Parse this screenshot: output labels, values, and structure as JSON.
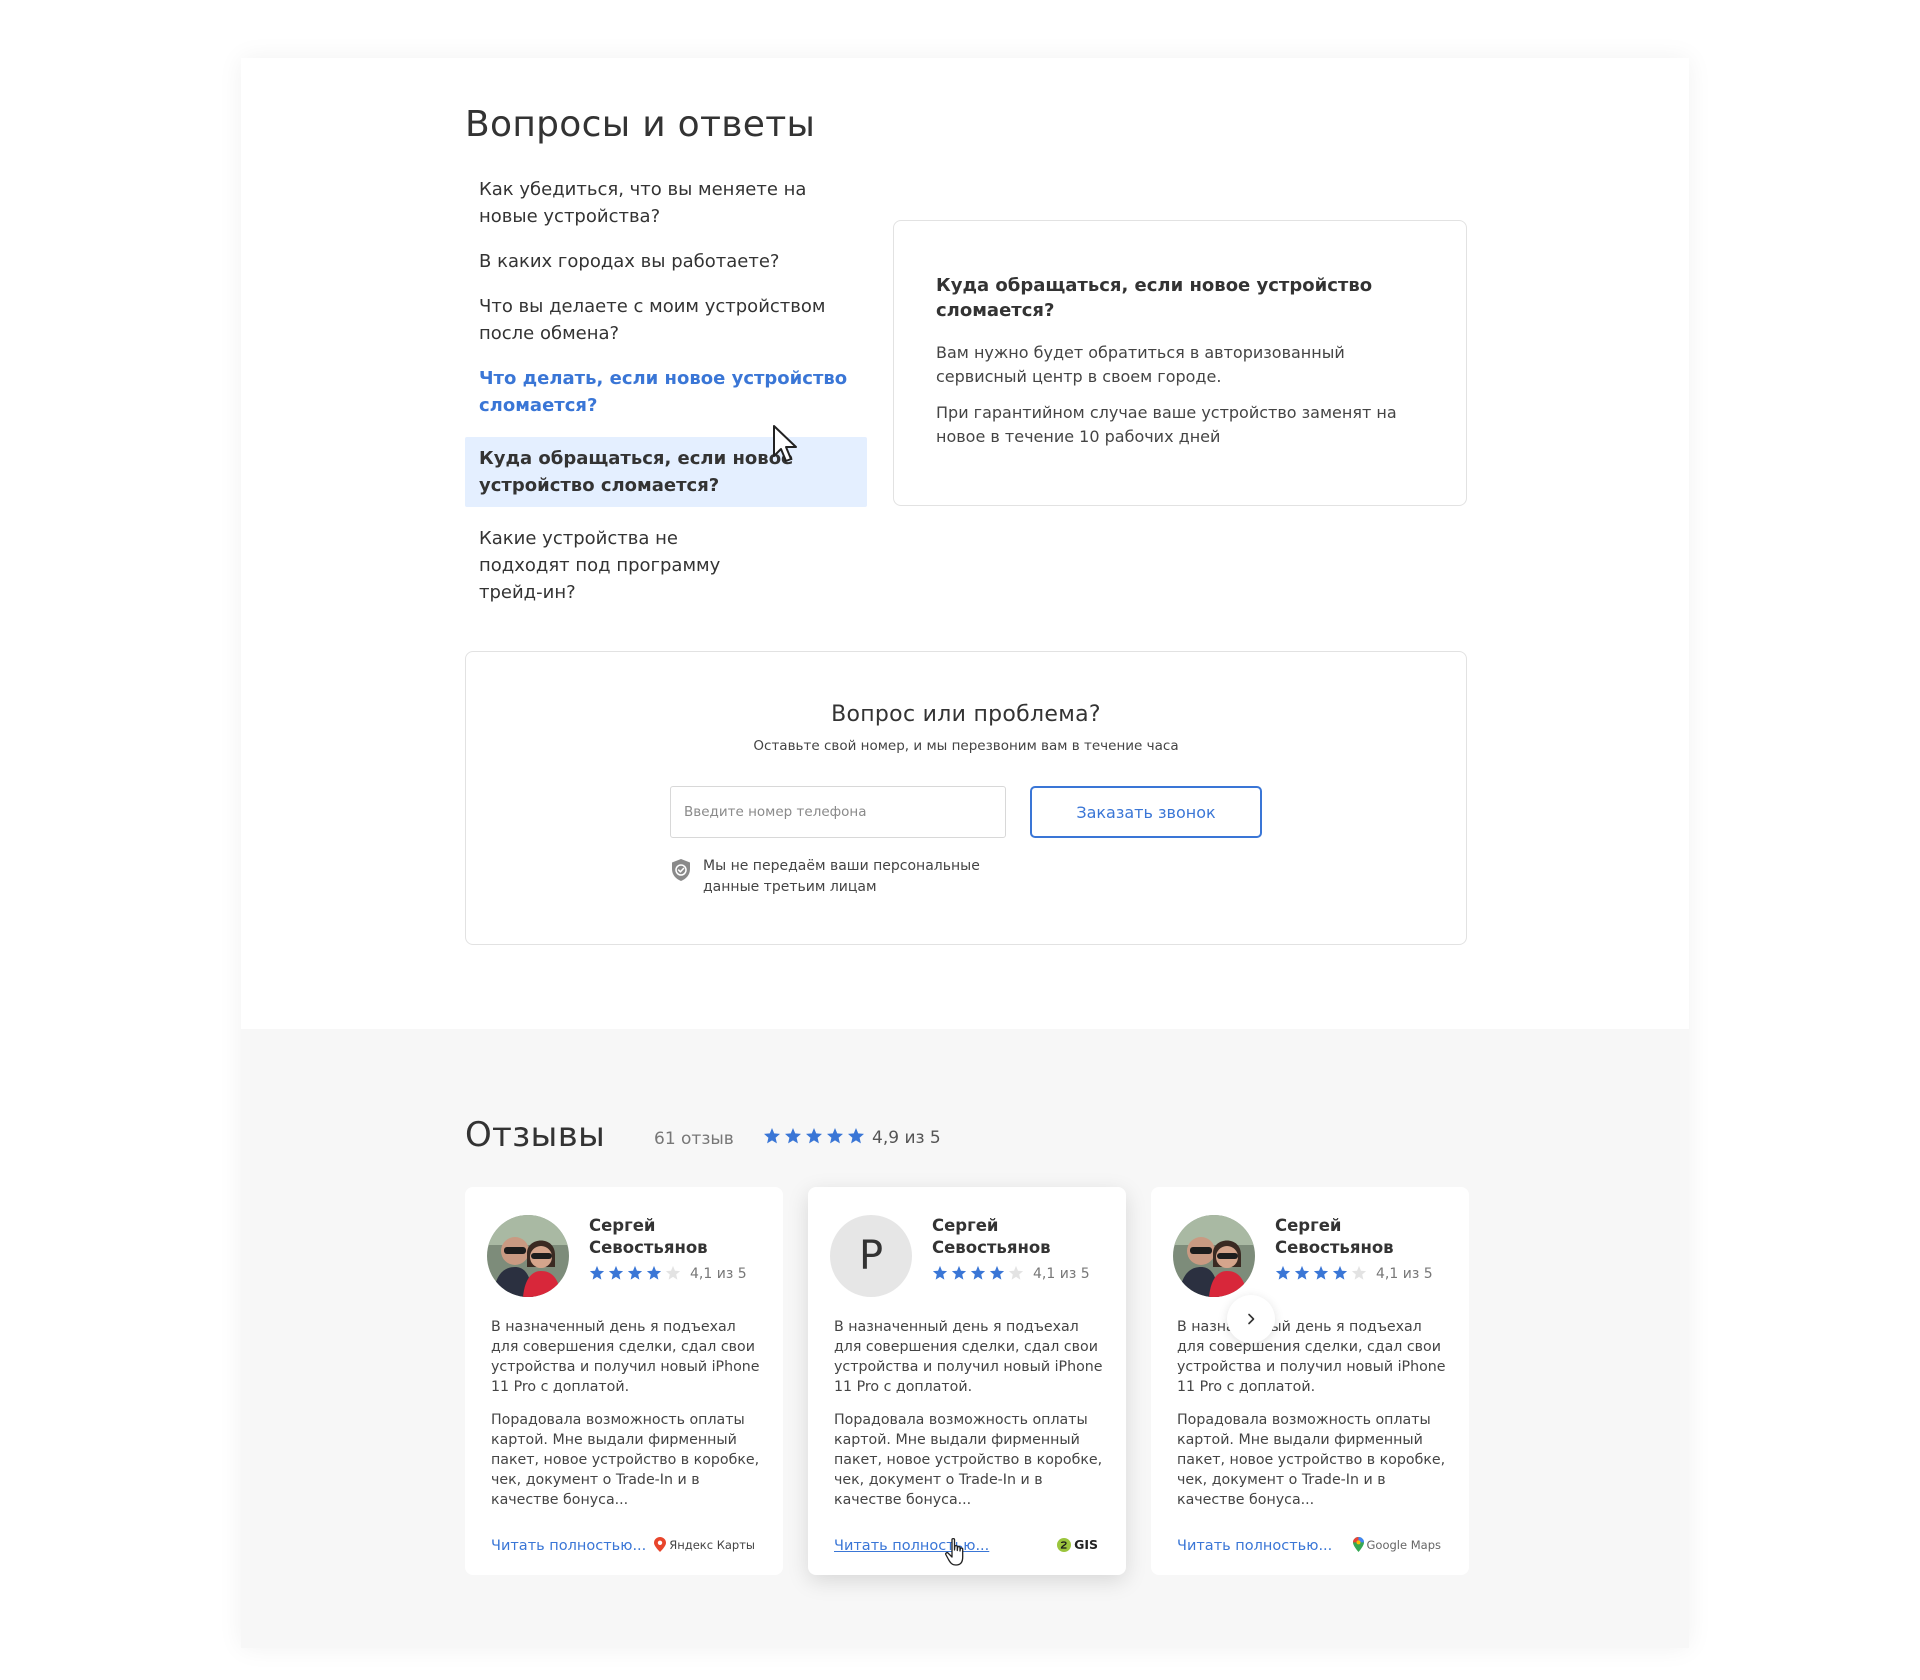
{
  "faq": {
    "title": "Вопросы и ответы",
    "questions": [
      "Как убедиться, что вы меняете на новые устройства?",
      "В каких городах вы работаете?",
      "Что вы делаете с моим устройством после обмена?",
      "Что делать, если новое устройство сломается?",
      "Куда обращаться, если новое устройство сломается?",
      "Какие устройства не подходят под программу трейд-ин?"
    ],
    "answer": {
      "title": "Куда обращаться, если новое устройство сломается?",
      "paragraphs": [
        "Вам нужно будет обратиться в авторизованный сервисный центр в своем городе.",
        "При гарантийном случае ваше устройство заменят на новое в течение 10 рабочих дней"
      ]
    }
  },
  "callback": {
    "title": "Вопрос или проблема?",
    "subtitle": "Оставьте свой номер, и мы перезвоним вам в течение часа",
    "phone_placeholder": "Введите номер телефона",
    "button_label": "Заказать звонок",
    "privacy_text": "Мы не передаём ваши персональные данные третьим лицам"
  },
  "reviews": {
    "title": "Отзывы",
    "count": "61 отзыв",
    "rating_text": "4,9 из 5",
    "rating_value": 4.9,
    "cards": [
      {
        "name": "Сергей Севостьянов",
        "avatar_letter": "",
        "rating_value": 4.1,
        "rating_text": "4,1 из 5",
        "paragraphs": [
          "В назначенный день я подъехал для совершения сделки, сдал свои устройства и получил новый iPhone 11 Pro с доплатой.",
          "Порадовала возможность оплаты картой. Мне выдали фирменный пакет, новое устройство в коробке, чек, документ о Trade-In и в качестве бонуса..."
        ],
        "link": "Читать полностью...",
        "source": "Яндекс Карты"
      },
      {
        "name": "Сергей Севостьянов",
        "avatar_letter": "Р",
        "rating_value": 4.1,
        "rating_text": "4,1 из 5",
        "paragraphs": [
          "В назначенный день я подъехал для совершения сделки, сдал свои устройства и получил новый iPhone 11 Pro с доплатой.",
          "Порадовала возможность оплаты картой. Мне выдали фирменный пакет, новое устройство в коробке, чек, документ о Trade-In и в качестве бонуса..."
        ],
        "link": "Читать полностью...",
        "source": "GIS"
      },
      {
        "name": "Сергей Севостьянов",
        "avatar_letter": "",
        "rating_value": 4.1,
        "rating_text": "4,1 из 5",
        "paragraphs": [
          "В назначенный день я подъехал для совершения сделки, сдал свои устройства и получил новый iPhone 11 Pro с доплатой.",
          "Порадовала возможность оплаты картой. Мне выдали фирменный пакет, новое устройство в коробке, чек, документ о Trade-In и в качестве бонуса..."
        ],
        "link": "Читать полностью...",
        "source": "Google Maps"
      }
    ]
  },
  "colors": {
    "accent": "#3a76d6",
    "active_bg": "#e4efff",
    "section_bg": "#f7f7f7"
  },
  "icons": [
    "cursor-arrow-icon",
    "shield-check-icon",
    "star-icon",
    "yandex-maps-pin-icon",
    "2gis-icon",
    "google-maps-pin-icon",
    "chevron-right-icon",
    "hand-cursor-icon"
  ]
}
